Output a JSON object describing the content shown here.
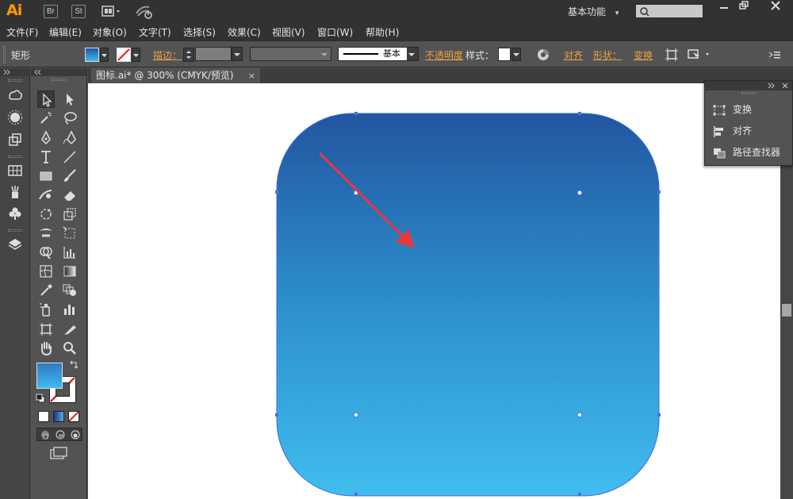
{
  "app": {
    "logo": "Ai",
    "br_badge": "Br",
    "st_badge": "St",
    "workspace_label": "基本功能",
    "workspace_arrow": "▾"
  },
  "menu": [
    {
      "label": "文件(F)"
    },
    {
      "label": "编辑(E)"
    },
    {
      "label": "对象(O)"
    },
    {
      "label": "文字(T)"
    },
    {
      "label": "选择(S)"
    },
    {
      "label": "效果(C)"
    },
    {
      "label": "视图(V)"
    },
    {
      "label": "窗口(W)"
    },
    {
      "label": "帮助(H)"
    }
  ],
  "control": {
    "object_type": "矩形",
    "stroke_label": "描边：",
    "stroke_profile": "基本",
    "opacity_label": "不透明度",
    "style_label": "样式：",
    "align_label": "对齐",
    "shape_label": "形状：",
    "transform_label": "变换"
  },
  "document": {
    "tab_title": "图标.ai* @ 300% (CMYK/预览)",
    "close_glyph": "×"
  },
  "float_panel": {
    "items": [
      {
        "label": "变换",
        "icon": "transform-icon"
      },
      {
        "label": "对齐",
        "icon": "align-icon"
      },
      {
        "label": "路径查找器",
        "icon": "pathfinder-icon"
      }
    ]
  },
  "colors": {
    "gradient_top": "#2256a0",
    "gradient_bottom": "#3fbbee",
    "arrow": "#e8383d",
    "accent_link": "#f0a040"
  }
}
